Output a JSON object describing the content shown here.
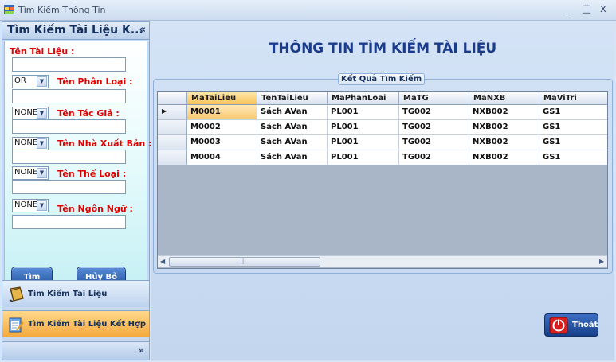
{
  "window": {
    "title": "Tìm Kiếm Thông Tin",
    "minimize": "_",
    "maximize": "□",
    "close": "x"
  },
  "nav": {
    "header": "Tìm Kiếm Tài Liệu K...",
    "collapse": "«",
    "expand": "»",
    "grip": "........",
    "items": [
      {
        "label": "Tìm Kiếm Tài Liệu",
        "active": false
      },
      {
        "label": "Tìm Kiếm Tài Liệu Kết Hợp",
        "active": true
      }
    ]
  },
  "search": {
    "fields": [
      {
        "label": "Tên Tài Liệu :",
        "value": ""
      },
      {
        "label": "Tên Phân Loại :",
        "operator": "OR",
        "value": ""
      },
      {
        "label": "Tên Tác Giả :",
        "operator": "NONE",
        "value": ""
      },
      {
        "label": "Tên Nhà Xuất Bản :",
        "operator": "NONE",
        "value": ""
      },
      {
        "label": "Tên Thể Loại :",
        "operator": "NONE",
        "value": ""
      },
      {
        "label": "Tên Ngôn Ngữ :",
        "operator": "NONE",
        "value": ""
      }
    ],
    "search_button": "Tìm Kiếm",
    "cancel_button": "Hủy Bỏ"
  },
  "main": {
    "title": "THÔNG TIN TÌM KIẾM TÀI LIỆU",
    "group_title": "Kết Quả Tìm Kiếm",
    "columns": [
      "MaTaiLieu",
      "TenTaiLieu",
      "MaPhanLoai",
      "MaTG",
      "MaNXB",
      "MaViTri"
    ],
    "rows": [
      [
        "M0001",
        "Sách AVan",
        "PL001",
        "TG002",
        "NXB002",
        "GS1"
      ],
      [
        "M0002",
        "Sách AVan",
        "PL001",
        "TG002",
        "NXB002",
        "GS1"
      ],
      [
        "M0003",
        "Sách AVan",
        "PL001",
        "TG002",
        "NXB002",
        "GS1"
      ],
      [
        "M0004",
        "Sách AVan",
        "PL001",
        "TG002",
        "NXB002",
        "GS1"
      ]
    ],
    "current_row_marker": "▶",
    "scroll_thumb_grip": "|||",
    "exit_button": "Thoát"
  }
}
